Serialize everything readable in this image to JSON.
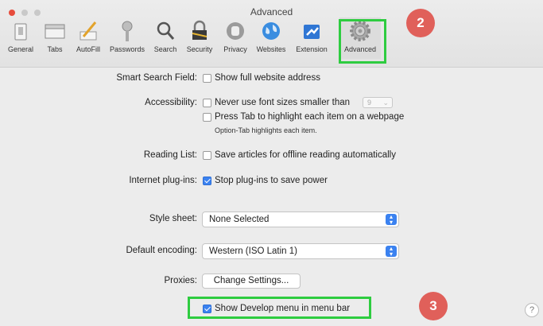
{
  "window": {
    "title": "Advanced"
  },
  "toolbar": {
    "items": [
      {
        "label": "General",
        "icon": "general-icon"
      },
      {
        "label": "Tabs",
        "icon": "tabs-icon"
      },
      {
        "label": "AutoFill",
        "icon": "autofill-icon"
      },
      {
        "label": "Passwords",
        "icon": "key-icon"
      },
      {
        "label": "Search",
        "icon": "search-icon"
      },
      {
        "label": "Security",
        "icon": "security-icon"
      },
      {
        "label": "Privacy",
        "icon": "privacy-icon"
      },
      {
        "label": "Websites",
        "icon": "globe-icon"
      },
      {
        "label": "Extension",
        "icon": "extensions-icon"
      },
      {
        "label": "Advanced",
        "icon": "gear-icon"
      }
    ],
    "selected": "Advanced"
  },
  "annotations": {
    "step2": "2",
    "step3": "3",
    "highlight_color": "#2ecc40",
    "badge_color": "#e0605a"
  },
  "settings": {
    "smart_search": {
      "label": "Smart Search Field:",
      "option": "Show full website address",
      "checked": false
    },
    "accessibility": {
      "label": "Accessibility:",
      "font_option": "Never use font sizes smaller than",
      "font_size": "9",
      "tab_option": "Press Tab to highlight each item on a webpage",
      "tab_hint": "Option-Tab highlights each item."
    },
    "reading_list": {
      "label": "Reading List:",
      "option": "Save articles for offline reading automatically"
    },
    "plugins": {
      "label": "Internet plug-ins:",
      "option": "Stop plug-ins to save power",
      "checked": true
    },
    "style_sheet": {
      "label": "Style sheet:",
      "value": "None Selected"
    },
    "encoding": {
      "label": "Default encoding:",
      "value": "Western (ISO Latin 1)"
    },
    "proxies": {
      "label": "Proxies:",
      "button": "Change Settings..."
    },
    "develop": {
      "option": "Show Develop menu in menu bar",
      "checked": true
    }
  },
  "help": {
    "symbol": "?"
  },
  "colors": {
    "accent": "#3b82f0"
  }
}
